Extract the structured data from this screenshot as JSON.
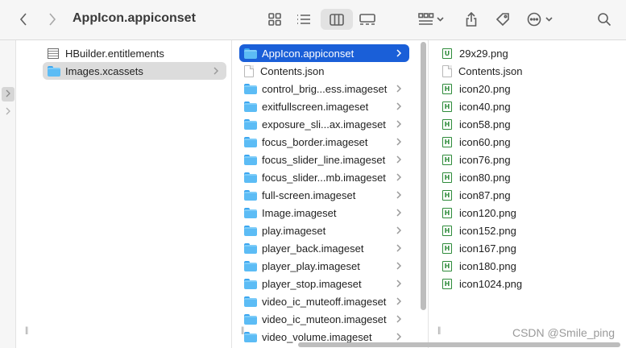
{
  "window": {
    "title": "AppIcon.appiconset"
  },
  "toolbar": {
    "back_icon": "chevron-left-icon",
    "forward_icon": "chevron-right-icon",
    "view_icons": [
      "grid-view-icon",
      "list-view-icon",
      "column-view-icon",
      "gallery-view-icon"
    ],
    "group_icon": "group-by-icon",
    "share_icon": "share-icon",
    "tag_icon": "tag-icon",
    "more_icon": "ellipsis-icon",
    "search_icon": "search-icon",
    "active_view": "column-view-icon"
  },
  "column1": {
    "items": [
      {
        "label": "HBuilder.entitlements",
        "kind": "entitlements",
        "selected": false,
        "has_children": false
      },
      {
        "label": "Images.xcassets",
        "kind": "folder",
        "selected": true,
        "has_children": true
      }
    ]
  },
  "column2": {
    "items": [
      {
        "label": "AppIcon.appiconset",
        "kind": "folder",
        "selected": true
      },
      {
        "label": "Contents.json",
        "kind": "doc",
        "selected": false
      },
      {
        "label": "control_brig...ess.imageset",
        "kind": "folder",
        "selected": false
      },
      {
        "label": "exitfullscreen.imageset",
        "kind": "folder",
        "selected": false
      },
      {
        "label": "exposure_sli...ax.imageset",
        "kind": "folder",
        "selected": false
      },
      {
        "label": "focus_border.imageset",
        "kind": "folder",
        "selected": false
      },
      {
        "label": "focus_slider_line.imageset",
        "kind": "folder",
        "selected": false
      },
      {
        "label": "focus_slider...mb.imageset",
        "kind": "folder",
        "selected": false
      },
      {
        "label": "full-screen.imageset",
        "kind": "folder",
        "selected": false
      },
      {
        "label": "Image.imageset",
        "kind": "folder",
        "selected": false
      },
      {
        "label": "play.imageset",
        "kind": "folder",
        "selected": false
      },
      {
        "label": "player_back.imageset",
        "kind": "folder",
        "selected": false
      },
      {
        "label": "player_play.imageset",
        "kind": "folder",
        "selected": false
      },
      {
        "label": "player_stop.imageset",
        "kind": "folder",
        "selected": false
      },
      {
        "label": "video_ic_muteoff.imageset",
        "kind": "folder",
        "selected": false
      },
      {
        "label": "video_ic_muteon.imageset",
        "kind": "folder",
        "selected": false
      },
      {
        "label": "video_volume.imageset",
        "kind": "folder",
        "selected": false
      }
    ]
  },
  "column3": {
    "items": [
      {
        "label": "29x29.png",
        "kind": "png-u"
      },
      {
        "label": "Contents.json",
        "kind": "doc"
      },
      {
        "label": "icon20.png",
        "kind": "png"
      },
      {
        "label": "icon40.png",
        "kind": "png"
      },
      {
        "label": "icon58.png",
        "kind": "png"
      },
      {
        "label": "icon60.png",
        "kind": "png"
      },
      {
        "label": "icon76.png",
        "kind": "png"
      },
      {
        "label": "icon80.png",
        "kind": "png"
      },
      {
        "label": "icon87.png",
        "kind": "png"
      },
      {
        "label": "icon120.png",
        "kind": "png"
      },
      {
        "label": "icon152.png",
        "kind": "png"
      },
      {
        "label": "icon167.png",
        "kind": "png"
      },
      {
        "label": "icon180.png",
        "kind": "png"
      },
      {
        "label": "icon1024.png",
        "kind": "png"
      }
    ]
  },
  "watermark": "CSDN @Smile_ping"
}
